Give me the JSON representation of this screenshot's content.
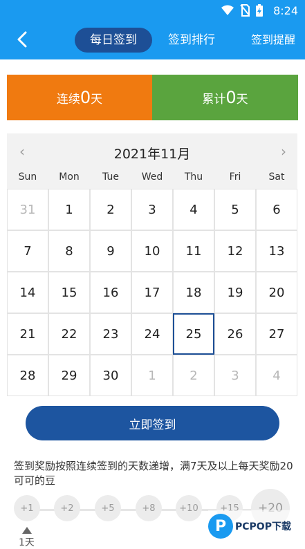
{
  "status_bar": {
    "time": "8:24",
    "icons": [
      "wifi-icon",
      "no-sim-icon",
      "battery-charging-icon"
    ]
  },
  "header": {
    "back_icon": "chevron-left-icon",
    "tabs": [
      {
        "label": "每日签到",
        "active": true
      },
      {
        "label": "签到排行",
        "active": false
      },
      {
        "label": "签到提醒",
        "active": false
      }
    ]
  },
  "streak": {
    "continuous_prefix": "连续",
    "continuous_value": "0",
    "continuous_suffix": "天",
    "total_prefix": "累计",
    "total_value": "0",
    "total_suffix": "天",
    "colors": {
      "continuous": "#f07a10",
      "total": "#5aa43e"
    }
  },
  "calendar": {
    "title": "2021年11月",
    "weekdays": [
      "Sun",
      "Mon",
      "Tue",
      "Wed",
      "Thu",
      "Fri",
      "Sat"
    ],
    "days": [
      {
        "d": "31",
        "muted": true
      },
      {
        "d": "1"
      },
      {
        "d": "2"
      },
      {
        "d": "3"
      },
      {
        "d": "4"
      },
      {
        "d": "5"
      },
      {
        "d": "6"
      },
      {
        "d": "7"
      },
      {
        "d": "8"
      },
      {
        "d": "9"
      },
      {
        "d": "10"
      },
      {
        "d": "11"
      },
      {
        "d": "12"
      },
      {
        "d": "13"
      },
      {
        "d": "14"
      },
      {
        "d": "15"
      },
      {
        "d": "16"
      },
      {
        "d": "17"
      },
      {
        "d": "18"
      },
      {
        "d": "19"
      },
      {
        "d": "20"
      },
      {
        "d": "21"
      },
      {
        "d": "22"
      },
      {
        "d": "23"
      },
      {
        "d": "24"
      },
      {
        "d": "25",
        "today": true
      },
      {
        "d": "26"
      },
      {
        "d": "27"
      },
      {
        "d": "28"
      },
      {
        "d": "29"
      },
      {
        "d": "30"
      },
      {
        "d": "1",
        "muted": true
      },
      {
        "d": "2",
        "muted": true
      },
      {
        "d": "3",
        "muted": true
      },
      {
        "d": "4",
        "muted": true
      }
    ]
  },
  "signin_button": "立即签到",
  "reward_info": "签到奖励按照连续签到的天数递增，满7天及以上每天奖励20可可的豆",
  "rewards": [
    "+1",
    "+2",
    "+5",
    "+8",
    "+10",
    "+15",
    "+20"
  ],
  "reward_day_label": "1天",
  "watermark": {
    "letter": "P",
    "brand": "PCPOP下载"
  }
}
